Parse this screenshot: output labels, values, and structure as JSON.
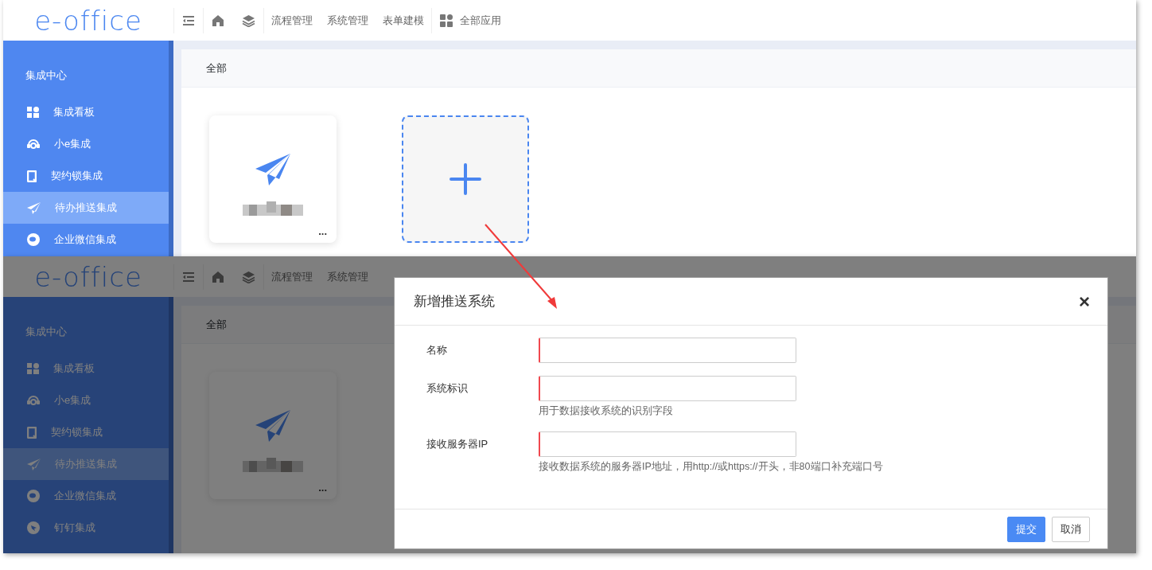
{
  "screens": [
    {
      "dimmed": false,
      "header": {
        "logo": "e-office",
        "toolbar": [
          {
            "kind": "collapse"
          },
          {
            "kind": "home"
          },
          {
            "kind": "layers"
          }
        ],
        "nav": [
          "流程管理",
          "系统管理",
          "表单建模"
        ],
        "apps": {
          "kind": "grid",
          "label": "全部应用"
        }
      },
      "sidebar": {
        "title": "集成中心",
        "items": [
          {
            "kind": "dashboard",
            "label": "集成看板",
            "selected": false
          },
          {
            "kind": "headset",
            "label": "小e集成",
            "selected": false
          },
          {
            "kind": "lock",
            "label": "契约锁集成",
            "selected": false
          },
          {
            "kind": "plane",
            "label": "待办推送集成",
            "selected": true
          },
          {
            "kind": "chat",
            "label": "企业微信集成",
            "selected": false
          }
        ]
      },
      "tab": "全部",
      "cards": [
        {
          "kind": "system",
          "more": "..."
        },
        {
          "kind": "add"
        }
      ]
    },
    {
      "dimmed": true,
      "header": {
        "logo": "e-office",
        "toolbar": [
          {
            "kind": "collapse"
          },
          {
            "kind": "home"
          },
          {
            "kind": "layers"
          }
        ],
        "nav": [
          "流程管理",
          "系统管理"
        ]
      },
      "sidebar": {
        "title": "集成中心",
        "items": [
          {
            "kind": "dashboard",
            "label": "集成看板",
            "selected": false
          },
          {
            "kind": "headset",
            "label": "小e集成",
            "selected": false
          },
          {
            "kind": "lock",
            "label": "契约锁集成",
            "selected": false
          },
          {
            "kind": "plane",
            "label": "待办推送集成",
            "selected": true
          },
          {
            "kind": "chat",
            "label": "企业微信集成",
            "selected": false
          },
          {
            "kind": "ding",
            "label": "钉钉集成",
            "selected": false
          }
        ]
      },
      "tab": "全部",
      "cards": [
        {
          "kind": "system",
          "more": "..."
        }
      ]
    }
  ],
  "modal": {
    "title": "新增推送系统",
    "close": "×",
    "fields": [
      {
        "label": "名称",
        "required": true
      },
      {
        "label": "系统标识",
        "required": true,
        "help": "用于数据接收系统的识别字段"
      },
      {
        "label": "接收服务器IP",
        "required": true,
        "help": "接收数据系统的服务器IP地址，用http://或https://开头，非80端口补充端口号"
      }
    ],
    "buttons": [
      {
        "label": "提交",
        "kind": "primary"
      },
      {
        "label": "取消",
        "kind": "default"
      }
    ]
  }
}
